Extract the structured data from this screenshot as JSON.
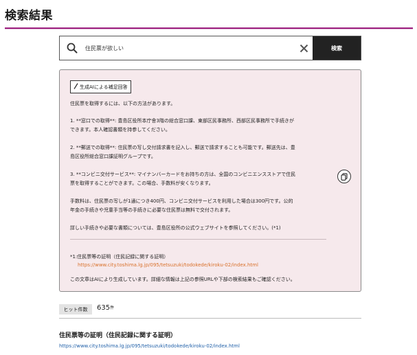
{
  "page": {
    "title": "検索結果"
  },
  "search": {
    "value": "住民票が欲しい",
    "button_label": "検索"
  },
  "ai_answer": {
    "badge_label": "生成AIによる補足回答",
    "intro": "住民票を取得するには、以下の方法があります。",
    "method1_line1": "1. **窓口での取得**: 豊島区役所本庁舎3階の総合窓口課、東部区民事務所、西部区民事務所で手続きが",
    "method1_line2": "できます。本人確認書類を持参してください。",
    "method2_line1": "2. **郵送での取得**: 住民票の写し交付請求書を記入し、郵送で請求することも可能です。郵送先は、豊",
    "method2_line2": "島区役所総合窓口課証明グループです。",
    "method3_line1": "3. **コンビニ交付サービス**: マイナンバーカードをお持ちの方は、全国のコンビニエンスストアで住民",
    "method3_line2": "票を取得することができます。この場合、手数料が安くなります。",
    "fee_line1": "手数料は、住民票の写しが1通につき400円、コンビニ交付サービスを利用した場合は300円です。公的",
    "fee_line2": "年金の手続きや児童手当等の手続きに必要な住民票は無料で交付されます。",
    "details": "詳しい手続きや必要な書類については、豊島区役所の公式ウェブサイトを参照してください。(*1)",
    "ref_label": "*1:住民票等の証明（住民記録に関する証明）",
    "ref_url": "https://www.city.toshima.lg.jp/095/tetsuzuki/todokede/kiroku-02/index.html",
    "disclaimer": "この文章はAIにより生成しています。詳細な情報は上記の参照URLや下部の検索結果もご確認ください。"
  },
  "results": {
    "hit_label": "ヒット件数",
    "hit_count": "635",
    "hit_unit": "件",
    "items": [
      {
        "title": "住民票等の証明（住民記録に関する証明）",
        "url": "https://www.city.toshima.lg.jp/095/tetsuzuki/todokede/kiroku-02/index.html"
      }
    ]
  },
  "colors": {
    "accent": "#9c1f7e",
    "ai_box_bg": "#f6e9ec",
    "ref_link": "#d9712a",
    "result_link": "#1f5fa8"
  },
  "icons": {
    "search": "search-icon",
    "clear": "close-icon",
    "badge": "pencil-icon",
    "copy": "copy-icon"
  }
}
